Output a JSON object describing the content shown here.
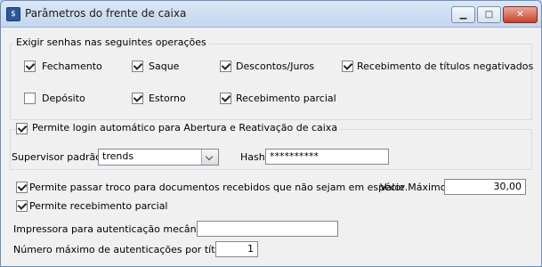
{
  "window": {
    "title": "Parâmetros do frente de caixa",
    "min": "▁",
    "max": "□",
    "close": "✕"
  },
  "senhas": {
    "legend": "Exigir senhas nas seguintes operações",
    "items": [
      {
        "label": "Fechamento",
        "checked": true
      },
      {
        "label": "Saque",
        "checked": true
      },
      {
        "label": "Descontos/Juros",
        "checked": true
      },
      {
        "label": "Recebimento de títulos negativados",
        "checked": true
      },
      {
        "label": "Depósito",
        "checked": false
      },
      {
        "label": "Estorno",
        "checked": true
      },
      {
        "label": "Recebimento parcial",
        "checked": true
      }
    ]
  },
  "login": {
    "label": "Permite login automático para Abertura e Reativação de caixa",
    "checked": true,
    "supervisor_label": "Supervisor padrão:",
    "supervisor_value": "trends",
    "hash_label": "Hash:",
    "hash_value": "**********"
  },
  "troco": {
    "label": "Permite passar troco para documentos recebidos que não sejam em espécie.",
    "checked": true,
    "valor_label": "Valor Máximo:",
    "valor_value": "30,00"
  },
  "receb_parcial": {
    "label": "Permite recebimento parcial",
    "checked": true
  },
  "impressora": {
    "label": "Impressora para autenticação mecânica:",
    "value": ""
  },
  "autenticacoes": {
    "label": "Número máximo de autenticações por título:",
    "value": "1"
  }
}
